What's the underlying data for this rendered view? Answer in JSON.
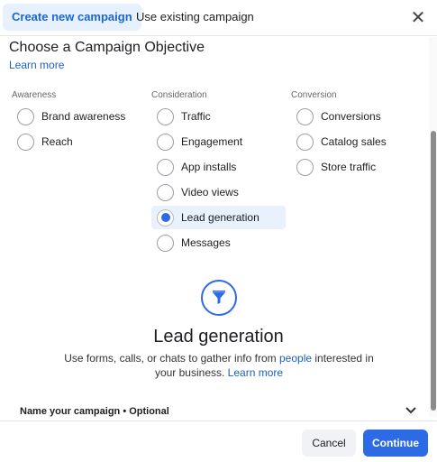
{
  "header": {
    "tabs": [
      {
        "label": "Create new campaign",
        "active": true
      },
      {
        "label": "Use existing campaign",
        "active": false
      }
    ],
    "close_icon": "close-icon"
  },
  "objective": {
    "title": "Choose a Campaign Objective",
    "learn_more": "Learn more"
  },
  "columns": [
    {
      "heading": "Awareness",
      "options": [
        "Brand awareness",
        "Reach"
      ]
    },
    {
      "heading": "Consideration",
      "options": [
        "Traffic",
        "Engagement",
        "App installs",
        "Video views",
        "Lead generation",
        "Messages"
      ]
    },
    {
      "heading": "Conversion",
      "options": [
        "Conversions",
        "Catalog sales",
        "Store traffic"
      ]
    }
  ],
  "selected_option": "Lead generation",
  "detail": {
    "icon": "funnel-icon",
    "title": "Lead generation",
    "description_part1": "Use forms, calls, or chats to gather info from ",
    "description_link1": "people",
    "description_part2": " interested in your business. ",
    "description_link2": "Learn more"
  },
  "name_campaign": {
    "label": "Name your campaign • Optional",
    "chevron_icon": "chevron-down-icon"
  },
  "footer": {
    "cancel_label": "Cancel",
    "continue_label": "Continue"
  },
  "colors": {
    "accent": "#2d6ae6",
    "selected_bg": "#e8f1fc",
    "active_tab_bg": "#e7f0fd"
  }
}
